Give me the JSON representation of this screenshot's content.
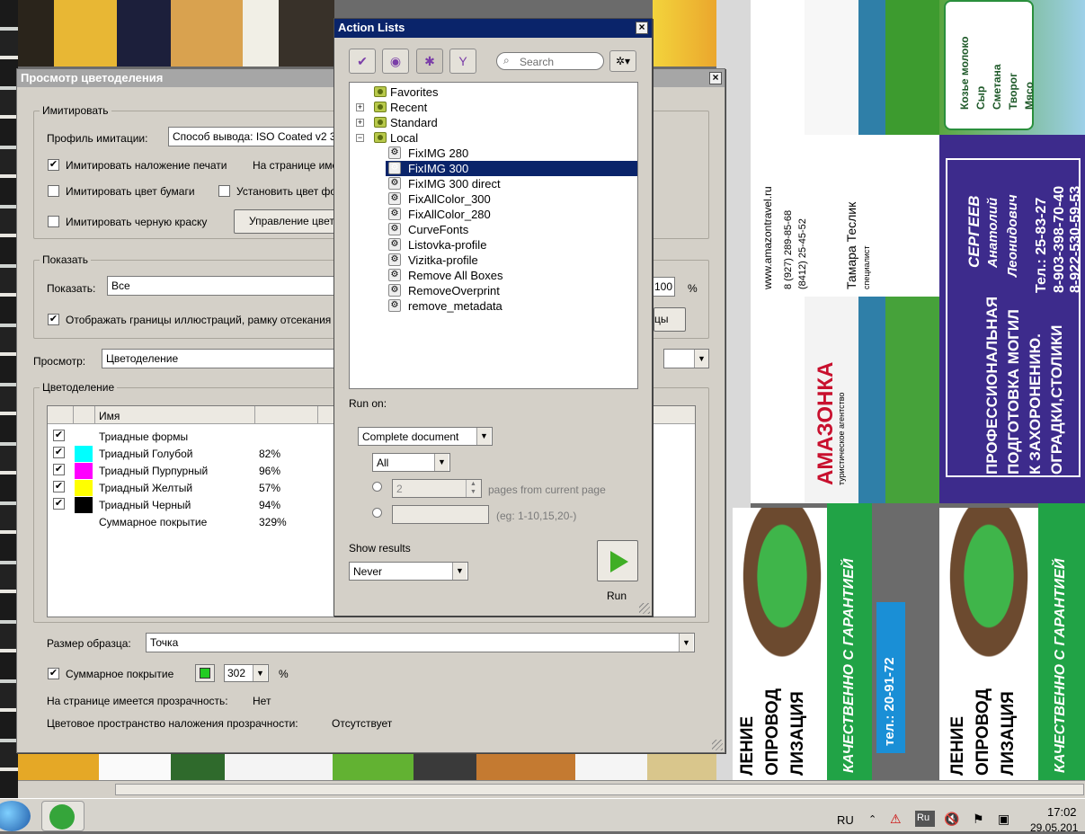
{
  "background_doc": {
    "card1_phone": "тел.: 20-91-72",
    "card1_slogan": "КАЧЕСТВЕННО С ГАРАНТИЕЙ",
    "card_text_a": "ЛЕНИЕ",
    "card_text_b": "ОПРОВОД",
    "card_text_c": "ЛИЗАЦИЯ",
    "amazonka_brand": "АМАЗОНКА",
    "amazonka_sub": "туристическое агентство",
    "amazonka_site": "www.amazontravel.ru",
    "amazonka_phone1": "8 (927) 289-85-68",
    "amazonka_phone2": "(8412) 25-45-52",
    "amazonka_name": "Тамара Теслик",
    "amazonka_role": "специалист",
    "farm_items": [
      "Козье молоко",
      "Сыр",
      "Сметана",
      "Творог",
      "Мясо"
    ],
    "purple_name": "СЕРГЕЕВ",
    "purple_first": "Анатолий",
    "purple_middle": "Леонидович",
    "purple_tel1": "Тел.: 25-83-27",
    "purple_tel2": "8-903-398-70-40",
    "purple_tel3": "8-922-530-59-53",
    "purple_line1": "ПРОФЕССИОНАЛЬНАЯ",
    "purple_line2": "ПОДГОТОВКА МОГИЛ",
    "purple_line3": "К ЗАХОРОНЕНИЮ.",
    "purple_line4": "ОГРАДКИ,СТОЛИКИ"
  },
  "separation_window": {
    "title": "Просмотр цветоделения",
    "simulate_group": "Имитировать",
    "simulation_profile_label": "Профиль имитации:",
    "simulation_profile_value": "Способ вывода: ISO Coated v2 300",
    "simulate_overprint": "Имитировать наложение печати",
    "on_page_label": "На странице име",
    "simulate_paper": "Имитировать цвет бумаги",
    "set_page": "Установить цвет фо",
    "simulate_black": "Имитировать черную краску",
    "manage_colors_button": "Управление цвет",
    "show_group": "Показать",
    "show_label": "Показать:",
    "show_value": "Все",
    "percent_value": "100",
    "percent_sign": "%",
    "show_borders": "Отображать границы иллюстраций, рамку отсекания",
    "borders_button_tail": "цы",
    "preview_label": "Просмотр:",
    "preview_value": "Цветоделение",
    "separations_group": "Цветоделение",
    "column_name": "Имя",
    "rows": [
      {
        "name": "Триадные формы",
        "value": "",
        "color": ""
      },
      {
        "name": "Триадный Голубой",
        "value": "82%",
        "color": "#00ffff"
      },
      {
        "name": "Триадный Пурпурный",
        "value": "96%",
        "color": "#ff00ff"
      },
      {
        "name": "Триадный Желтый",
        "value": "57%",
        "color": "#ffff00"
      },
      {
        "name": "Триадный Черный",
        "value": "94%",
        "color": "#000000"
      },
      {
        "name": "Суммарное покрытие",
        "value": "329%",
        "color": ""
      }
    ],
    "sample_size_label": "Размер образца:",
    "sample_size_value": "Точка",
    "total_coverage_label": "Суммарное покрытие",
    "total_coverage_value": "302",
    "total_coverage_unit": "%",
    "coverage_swatch_color": "#22cc22",
    "transparency_label": "На странице имеется прозрачность:",
    "transparency_value": "Нет",
    "blend_space_label": "Цветовое пространство наложения прозрачности:",
    "blend_space_value": "Отсутствует"
  },
  "action_lists": {
    "title": "Action Lists",
    "search_placeholder": "Search",
    "folders": [
      "Favorites",
      "Recent",
      "Standard",
      "Local"
    ],
    "actions": [
      "FixIMG 280",
      "FixIMG 300",
      "FixIMG 300 direct",
      "FixAllColor_300",
      "FixAllColor_280",
      "CurveFonts",
      "Listovka-profile",
      "Vizitka-profile",
      "Remove All Boxes",
      "RemoveOverprint",
      "remove_metadata"
    ],
    "selected_action": "FixIMG 300",
    "run_on_label": "Run on:",
    "run_on_value": "Complete document",
    "pages_value": "All",
    "pages_count": "2",
    "pages_from_current": "pages from current page",
    "range_hint": "(eg: 1-10,15,20-)",
    "show_results_label": "Show results",
    "show_results_value": "Never",
    "run_label": "Run",
    "accent_color": "#0a246a"
  },
  "taskbar": {
    "language": "RU",
    "lang_badge": "Ru",
    "time": "17:02",
    "date": "29.05.201"
  }
}
